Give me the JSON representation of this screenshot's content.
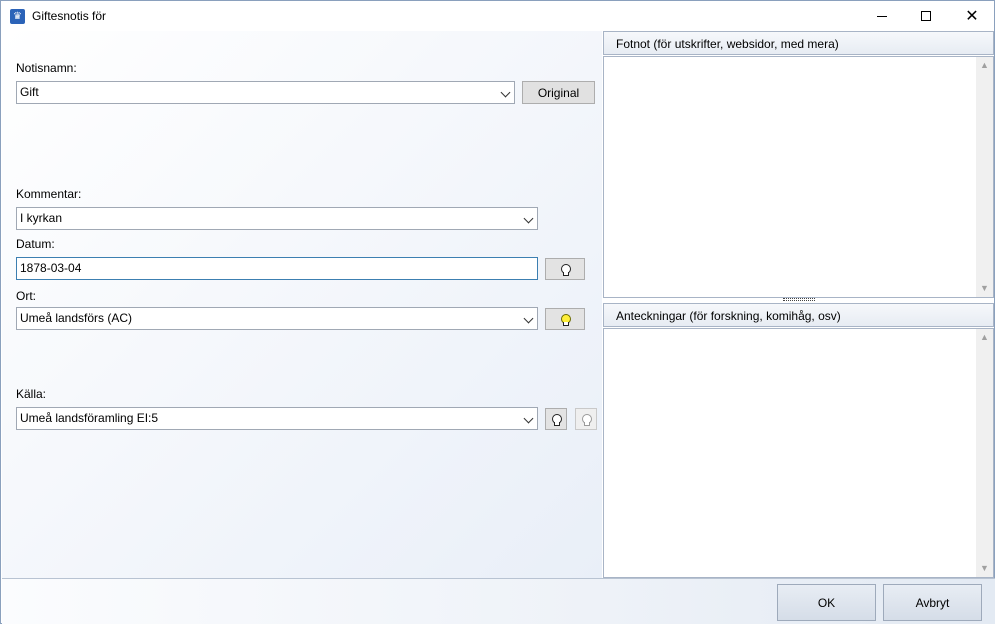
{
  "window": {
    "title": "Giftesnotis för"
  },
  "form": {
    "notisnamn_label": "Notisnamn:",
    "notisnamn_value": "Gift",
    "original_button": "Original",
    "kommentar_label": "Kommentar:",
    "kommentar_value": "I kyrkan",
    "datum_label": "Datum:",
    "datum_value": "1878-03-04",
    "ort_label": "Ort:",
    "ort_value": "Umeå landsförs (AC)",
    "kalla_label": "Källa:",
    "kalla_value": "Umeå landsföramling EI:5"
  },
  "notes": {
    "fotnot_header": "Fotnot (för utskrifter, websidor, med mera)",
    "anteckningar_header": "Anteckningar (för forskning, komihåg, osv)"
  },
  "footer": {
    "ok_label": "OK",
    "cancel_label": "Avbryt"
  },
  "icons": {
    "bulb_datum": "lightbulb-icon",
    "bulb_ort": "lightbulb-icon-lit",
    "bulb_kalla": "lightbulb-icon",
    "bulb_kalla_disabled": "lightbulb-disabled-icon"
  },
  "colors": {
    "accent": "#2b63b8",
    "focus_border": "#3c7fb1",
    "bulb_lit": "#ffef3a"
  }
}
